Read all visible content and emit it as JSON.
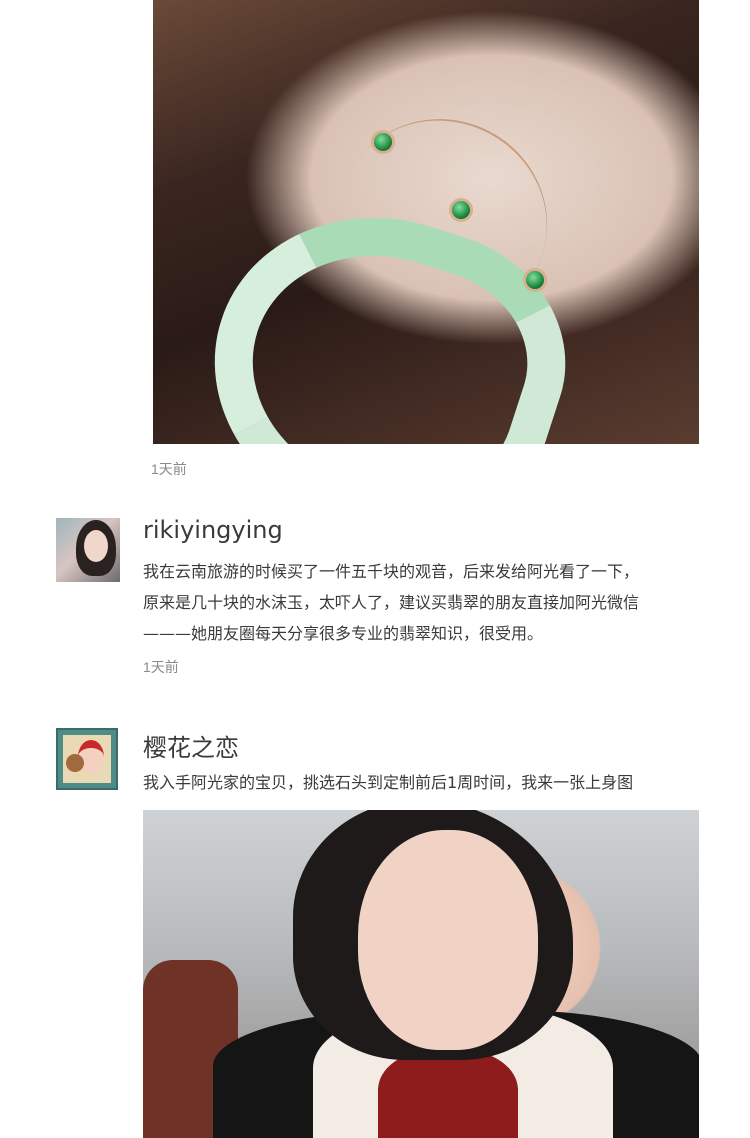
{
  "comments": [
    {
      "timestamp": "1天前"
    },
    {
      "username": "rikiyingying",
      "lines": [
        "我在云南旅游的时候买了一件五千块的观音，后来发给阿光看了一下，",
        "原来是几十块的水沫玉，太吓人了，建议买翡翠的朋友直接加阿光微信",
        "———她朋友圈每天分享很多专业的翡翠知识，很受用。"
      ],
      "timestamp": "1天前"
    },
    {
      "username": "樱花之恋",
      "lines": [
        "我入手阿光家的宝贝，挑选石头到定制前后1周时间，我来一张上身图"
      ]
    }
  ]
}
